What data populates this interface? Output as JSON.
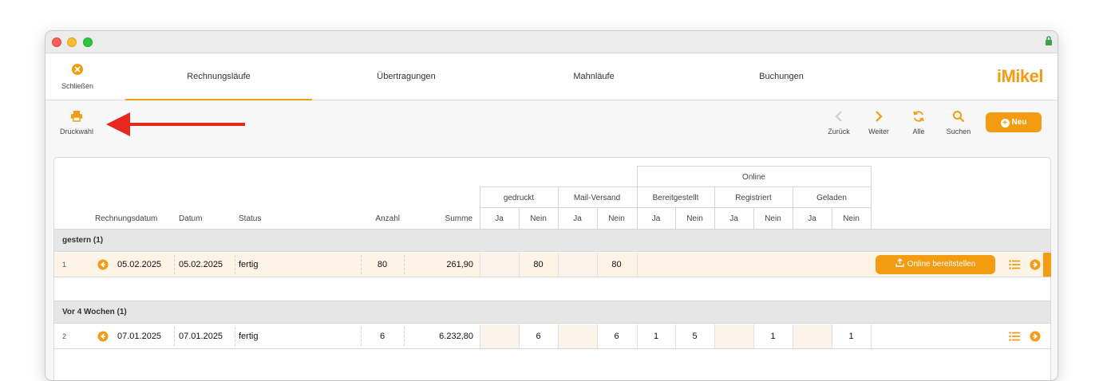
{
  "nav": {
    "close_label": "Schließen",
    "tabs": [
      {
        "label": "Rechnungsläufe"
      },
      {
        "label": "Übertragungen"
      },
      {
        "label": "Mahnläufe"
      },
      {
        "label": "Buchungen"
      }
    ],
    "logo_text": "iMikel"
  },
  "toolbar": {
    "print_label": "Druckwahl",
    "back_label": "Zurück",
    "next_label": "Weiter",
    "all_label": "Alle",
    "search_label": "Suchen",
    "new_label": "Neu"
  },
  "table": {
    "header": {
      "rechnungsdatum": "Rechnungsdatum",
      "datum": "Datum",
      "status": "Status",
      "anzahl": "Anzahl",
      "summe": "Summe",
      "gedruckt": "gedruckt",
      "mail": "Mail-Versand",
      "online": "Online",
      "bereitgestellt": "Bereitgestellt",
      "registriert": "Registriert",
      "geladen": "Geladen",
      "ja": "Ja",
      "nein": "Nein"
    },
    "groups": [
      {
        "title": "gestern (1)",
        "row": {
          "num": "1",
          "rechnungsdatum": "05.02.2025",
          "datum": "05.02.2025",
          "status": "fertig",
          "anzahl": "80",
          "summe": "261,90",
          "gedruckt_nein": "80",
          "mail_nein": "80",
          "action": "Online bereitstellen"
        }
      },
      {
        "title": "Vor 4 Wochen (1)",
        "row": {
          "num": "2",
          "rechnungsdatum": "07.01.2025",
          "datum": "07.01.2025",
          "status": "fertig",
          "anzahl": "6",
          "summe": "6.232,80",
          "gedruckt_nein": "6",
          "mail_nein": "6",
          "bereit_ja": "1",
          "bereit_nein": "5",
          "reg_nein": "1",
          "gel_nein": "1"
        }
      }
    ]
  },
  "colors": {
    "accent": "#f39c12",
    "arrow": "#e8281e"
  }
}
